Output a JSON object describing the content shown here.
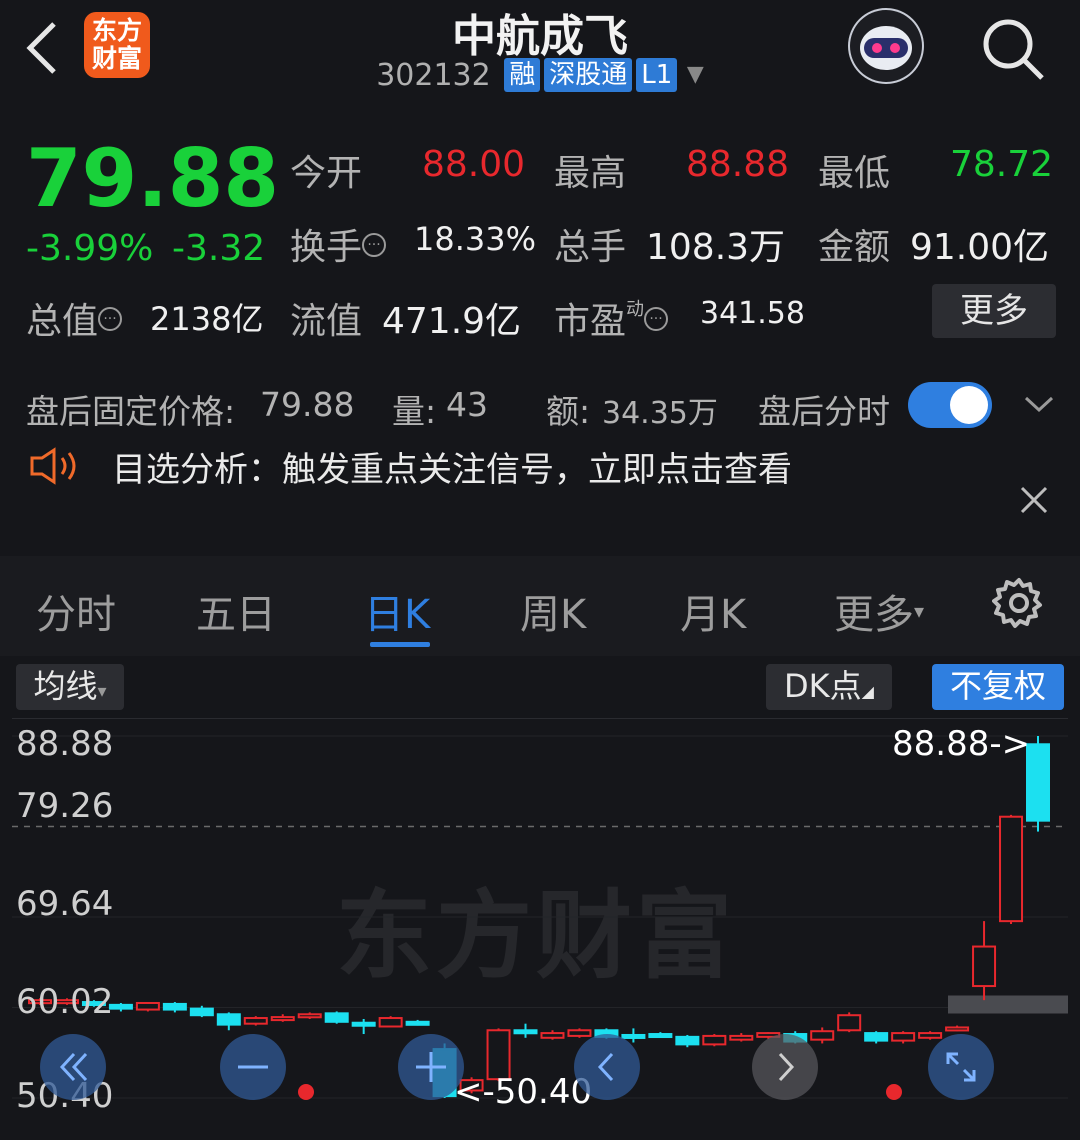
{
  "header": {
    "logo_line1": "东方",
    "logo_line2": "财富",
    "stock_name": "中航成飞",
    "stock_code": "302132",
    "tags": [
      "融",
      "深股通",
      "L1"
    ]
  },
  "quote": {
    "price": "79.88",
    "change_pct": "-3.99%",
    "change_amt": "-3.32",
    "open_label": "今开",
    "open": "88.00",
    "high_label": "最高",
    "high": "88.88",
    "low_label": "最低",
    "low": "78.72",
    "turnover_label": "换手",
    "turnover": "18.33%",
    "volume_label": "总手",
    "volume": "108.3万",
    "amount_label": "金额",
    "amount": "91.00亿",
    "mktcap_label": "总值",
    "mktcap": "2138亿",
    "float_label": "流值",
    "float_cap": "471.9亿",
    "pe_label": "市盈",
    "pe_sup": "动",
    "pe": "341.58",
    "more_button": "更多"
  },
  "after_hours": {
    "price_label": "盘后固定价格:",
    "price": "79.88",
    "vol_label": "量:",
    "vol": "43",
    "amt_label": "额:",
    "amt": "34.35万",
    "timeshare_label": "盘后分时",
    "toggle_on": true
  },
  "news": {
    "text": "目选分析：触发重点关注信号，立即点击查看"
  },
  "tabs": [
    "分时",
    "五日",
    "日K",
    "周K",
    "月K",
    "更多"
  ],
  "active_tab": "日K",
  "chart_toolbar": {
    "ma_label": "均线",
    "dk_label": "DK点",
    "adjust_label": "不复权"
  },
  "watermark": "东方财富",
  "colors": {
    "up": "#e8282d",
    "down": "#1ce0f0",
    "price_green": "#19d13a",
    "accent": "#2f7fe0"
  },
  "chart_data": {
    "type": "candlestick",
    "title": "",
    "y_ticks": [
      "88.88",
      "79.26",
      "69.64",
      "60.02",
      "50.40"
    ],
    "ylim": [
      50.4,
      88.88
    ],
    "reference_line": 79.26,
    "max_marker": "88.88->",
    "min_marker": "<-50.40",
    "candles": [
      {
        "o": 60.6,
        "c": 60.8,
        "h": 61.0,
        "l": 60.3
      },
      {
        "o": 60.5,
        "c": 60.8,
        "h": 61.0,
        "l": 60.3
      },
      {
        "o": 60.6,
        "c": 60.3,
        "h": 60.8,
        "l": 60.1
      },
      {
        "o": 60.3,
        "c": 59.9,
        "h": 60.5,
        "l": 59.6
      },
      {
        "o": 59.8,
        "c": 60.5,
        "h": 60.6,
        "l": 59.6
      },
      {
        "o": 60.4,
        "c": 59.8,
        "h": 60.6,
        "l": 59.5
      },
      {
        "o": 59.9,
        "c": 59.2,
        "h": 60.2,
        "l": 59.0
      },
      {
        "o": 59.3,
        "c": 58.2,
        "h": 59.5,
        "l": 57.6
      },
      {
        "o": 58.3,
        "c": 58.9,
        "h": 59.1,
        "l": 58.1
      },
      {
        "o": 58.7,
        "c": 59.0,
        "h": 59.3,
        "l": 58.5
      },
      {
        "o": 59.0,
        "c": 59.3,
        "h": 59.5,
        "l": 58.8
      },
      {
        "o": 59.4,
        "c": 58.5,
        "h": 59.6,
        "l": 58.3
      },
      {
        "o": 58.4,
        "c": 58.3,
        "h": 58.8,
        "l": 57.2
      },
      {
        "o": 58.0,
        "c": 58.9,
        "h": 59.1,
        "l": 57.9
      },
      {
        "o": 58.5,
        "c": 58.3,
        "h": 58.7,
        "l": 58.1
      },
      {
        "o": 55.6,
        "c": 50.6,
        "h": 56.2,
        "l": 50.4
      },
      {
        "o": 51.2,
        "c": 52.3,
        "h": 52.6,
        "l": 50.9
      },
      {
        "o": 52.4,
        "c": 57.6,
        "h": 57.8,
        "l": 52.2
      },
      {
        "o": 57.6,
        "c": 57.5,
        "h": 58.3,
        "l": 56.8
      },
      {
        "o": 56.8,
        "c": 57.3,
        "h": 57.6,
        "l": 56.6
      },
      {
        "o": 57.0,
        "c": 57.6,
        "h": 57.8,
        "l": 56.8
      },
      {
        "o": 57.6,
        "c": 56.9,
        "h": 57.8,
        "l": 56.7
      },
      {
        "o": 57.1,
        "c": 57.0,
        "h": 57.8,
        "l": 56.3
      },
      {
        "o": 57.2,
        "c": 57.1,
        "h": 57.4,
        "l": 56.9
      },
      {
        "o": 56.9,
        "c": 56.1,
        "h": 57.1,
        "l": 55.8
      },
      {
        "o": 56.1,
        "c": 57.0,
        "h": 57.2,
        "l": 55.9
      },
      {
        "o": 56.6,
        "c": 57.0,
        "h": 57.3,
        "l": 56.4
      },
      {
        "o": 56.9,
        "c": 57.3,
        "h": 57.4,
        "l": 56.7
      },
      {
        "o": 57.2,
        "c": 56.4,
        "h": 57.5,
        "l": 56.2
      },
      {
        "o": 56.6,
        "c": 57.5,
        "h": 57.9,
        "l": 56.2
      },
      {
        "o": 57.6,
        "c": 59.2,
        "h": 59.5,
        "l": 57.4
      },
      {
        "o": 57.3,
        "c": 56.5,
        "h": 57.5,
        "l": 56.2
      },
      {
        "o": 56.5,
        "c": 57.3,
        "h": 57.5,
        "l": 56.2
      },
      {
        "o": 56.8,
        "c": 57.3,
        "h": 57.5,
        "l": 56.6
      },
      {
        "o": 57.6,
        "c": 57.9,
        "h": 58.1,
        "l": 57.5
      },
      {
        "o": 62.3,
        "c": 66.5,
        "h": 69.2,
        "l": 60.8
      },
      {
        "o": 69.2,
        "c": 80.3,
        "h": 80.5,
        "l": 68.9
      },
      {
        "o": 88.0,
        "c": 79.88,
        "h": 88.88,
        "l": 78.72
      }
    ]
  }
}
